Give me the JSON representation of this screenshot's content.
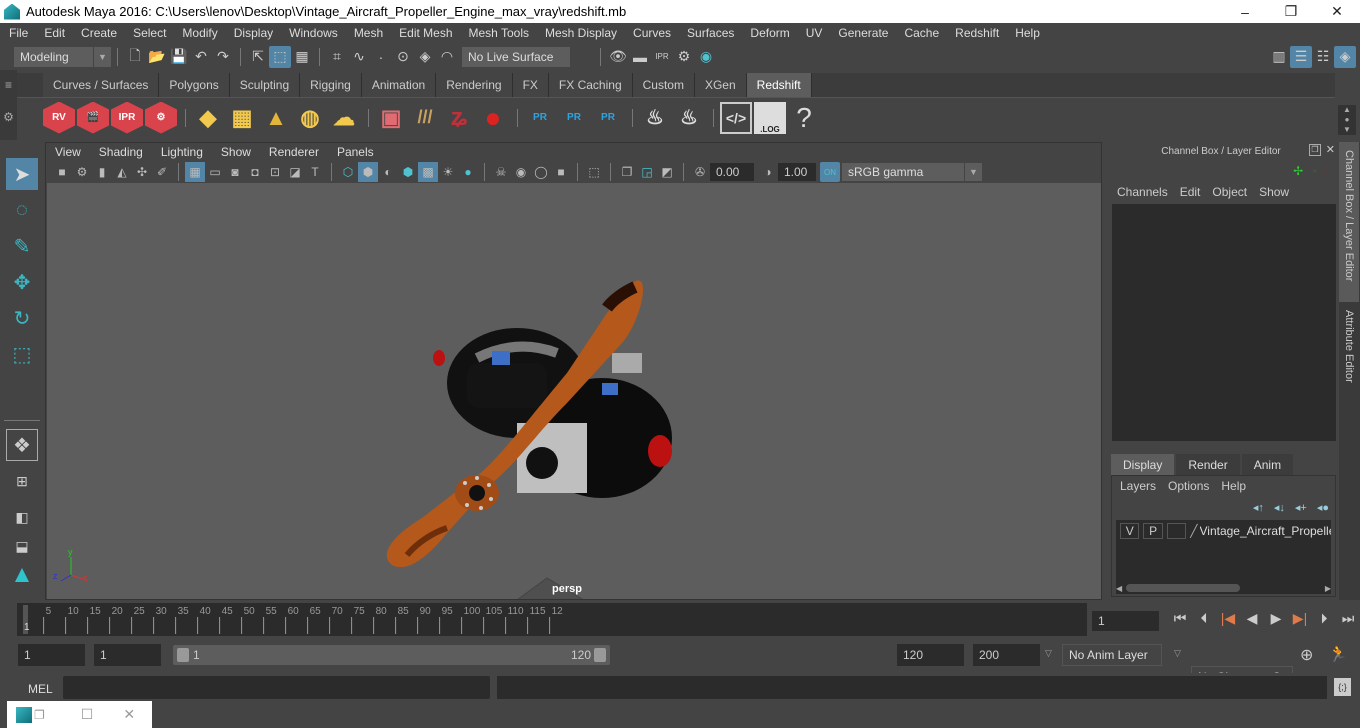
{
  "window": {
    "title": "Autodesk Maya 2016: C:\\Users\\lenov\\Desktop\\Vintage_Aircraft_Propeller_Engine_max_vray\\redshift.mb",
    "controls": {
      "minimize": "–",
      "restore": "❐",
      "close": "✕"
    }
  },
  "menubar": [
    "File",
    "Edit",
    "Create",
    "Select",
    "Modify",
    "Display",
    "Windows",
    "Mesh",
    "Edit Mesh",
    "Mesh Tools",
    "Mesh Display",
    "Curves",
    "Surfaces",
    "Deform",
    "UV",
    "Generate",
    "Cache",
    "Redshift",
    "Help"
  ],
  "statusline": {
    "mode": "Modeling",
    "live_surface": "No Live Surface",
    "render_icon_labels": {
      "ipr": "IPR"
    }
  },
  "shelf": {
    "tabs": [
      "Curves / Surfaces",
      "Polygons",
      "Sculpting",
      "Rigging",
      "Animation",
      "Rendering",
      "FX",
      "FX Caching",
      "Custom",
      "XGen",
      "Redshift"
    ],
    "active_tab": "Redshift",
    "redshift_labels": {
      "rv": "RV",
      "ipr": "IPR",
      "pr": "PR",
      "log": ".LOG",
      "help": "?"
    }
  },
  "viewport": {
    "menu": [
      "View",
      "Shading",
      "Lighting",
      "Show",
      "Renderer",
      "Panels"
    ],
    "exposure": "0.00",
    "gamma": "1.00",
    "color_mgmt_badge": "ON",
    "color_space": "sRGB gamma",
    "camera_label": "persp",
    "axis_labels": {
      "x": "x",
      "y": "y",
      "z": "z"
    }
  },
  "channel_box": {
    "title": "Channel Box / Layer Editor",
    "menu": [
      "Channels",
      "Edit",
      "Object",
      "Show"
    ]
  },
  "layer_editor": {
    "tabs": [
      "Display",
      "Render",
      "Anim"
    ],
    "active_tab": "Display",
    "menu": [
      "Layers",
      "Options",
      "Help"
    ],
    "layers": [
      {
        "v": "V",
        "p": "P",
        "name": "Vintage_Aircraft_Propelle"
      }
    ]
  },
  "side_tabs": [
    "Channel Box / Layer Editor",
    "Attribute Editor"
  ],
  "timeline": {
    "ticks": [
      "5",
      "10",
      "15",
      "20",
      "25",
      "30",
      "35",
      "40",
      "45",
      "50",
      "55",
      "60",
      "65",
      "70",
      "75",
      "80",
      "85",
      "90",
      "95",
      "100",
      "105",
      "110",
      "115",
      "12"
    ],
    "current_frame_marker": "1",
    "current_frame": "1"
  },
  "range": {
    "start_time": "1",
    "playback_start": "1",
    "slider_start": "1",
    "slider_end": "120",
    "playback_end": "120",
    "end_time": "200",
    "anim_layer": "No Anim Layer",
    "character_set": "No Character Set"
  },
  "command_line": {
    "label": "MEL",
    "value": "",
    "result": ""
  }
}
